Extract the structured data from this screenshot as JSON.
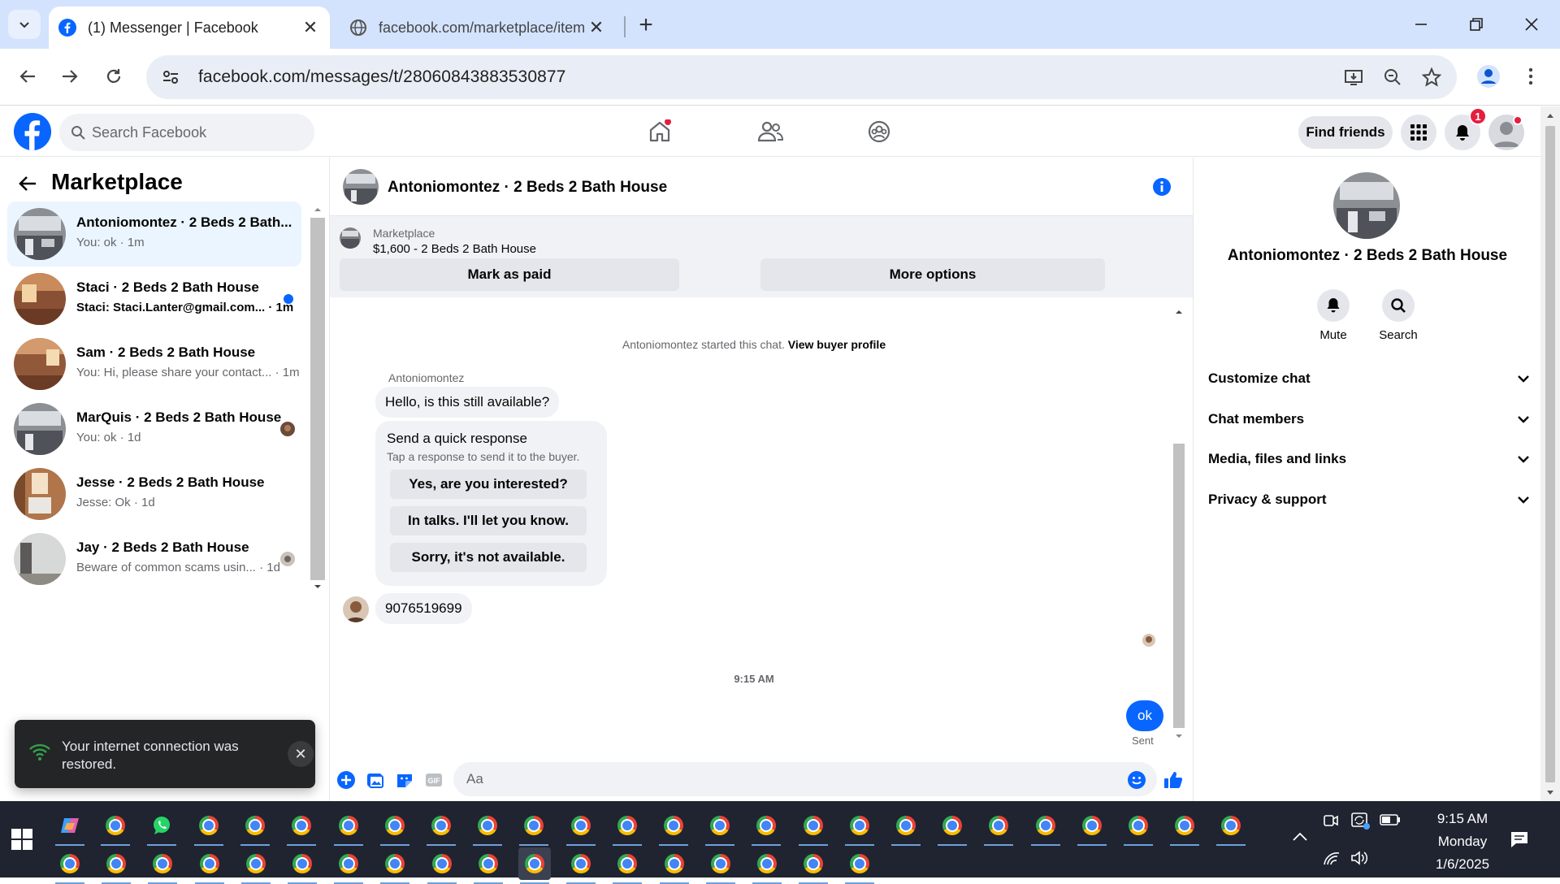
{
  "browser": {
    "tabs": [
      {
        "title": "(1) Messenger | Facebook",
        "active": true
      },
      {
        "title": "facebook.com/marketplace/item",
        "active": false
      }
    ],
    "url": "facebook.com/messages/t/28060843883530877"
  },
  "header": {
    "search_placeholder": "Search Facebook",
    "find_friends": "Find friends",
    "notification_count": "1"
  },
  "sidebar": {
    "title": "Marketplace",
    "conversations": [
      {
        "name": "Antoniomontez · 2 Beds 2 Bath...",
        "snippet": "You: ok · 1m",
        "selected": true
      },
      {
        "name": "Staci · 2 Beds 2 Bath House",
        "snippet": "Staci: Staci.Lanter@gmail.com... · 1m",
        "unread": true
      },
      {
        "name": "Sam · 2 Beds 2 Bath House",
        "snippet": "You: Hi, please share your contact... · 1m"
      },
      {
        "name": "MarQuis · 2 Beds 2 Bath House",
        "snippet": "You: ok · 1d"
      },
      {
        "name": "Jesse · 2 Beds 2 Bath House",
        "snippet": "Jesse: Ok · 1d"
      },
      {
        "name": "Jay · 2 Beds 2 Bath House",
        "snippet": "Beware of common scams usin... · 1d"
      }
    ],
    "toast": "Your internet connection was restored."
  },
  "chat": {
    "title": "Antoniomontez · 2 Beds 2 Bath House",
    "marketplace_label": "Marketplace",
    "listing": "$1,600 - 2 Beds 2 Bath House",
    "mark_paid": "Mark as paid",
    "more_options": "More options",
    "system_message": "Antoniomontez started this chat.",
    "view_buyer": "View buyer profile",
    "sender": "Antoniomontez",
    "first_message": "Hello, is this still available?",
    "quick_title": "Send a quick response",
    "quick_subtitle": "Tap a response to send it to the buyer.",
    "quick_responses": [
      "Yes, are you interested?",
      "In talks. I'll let you know.",
      "Sorry, it's not available."
    ],
    "phone_message": "9076519699",
    "timestamp": "9:15 AM",
    "my_message": "ok",
    "status": "Sent",
    "composer_placeholder": "Aa"
  },
  "details": {
    "name": "Antoniomontez · 2 Beds 2 Bath House",
    "mute": "Mute",
    "search": "Search",
    "sections": [
      "Customize chat",
      "Chat members",
      "Media, files and links",
      "Privacy & support"
    ]
  },
  "taskbar": {
    "time": "9:15 AM",
    "day": "Monday",
    "date": "1/6/2025"
  },
  "colors": {
    "brand": "#0866ff",
    "chrome_tabbar": "#d3e3fd",
    "taskbar": "#1f2430"
  }
}
